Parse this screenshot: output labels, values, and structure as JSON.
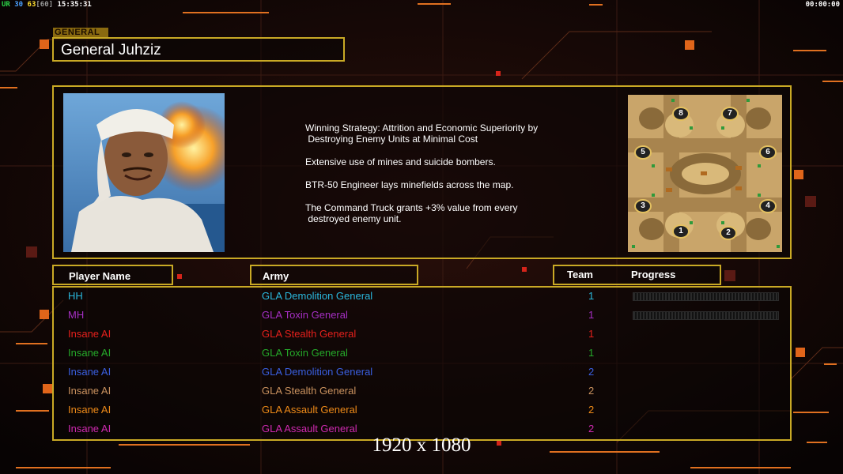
{
  "hud": {
    "left_prefix": "UR",
    "fps": "30",
    "fps2": "63",
    "fps_cap": "[60]",
    "clock": "15:35:31",
    "game_timer": "00:00:00"
  },
  "general": {
    "section_tag": "GENERAL",
    "name": "General Juhziz",
    "description": [
      "Winning Strategy: Attrition and Economic Superiority by\n Destroying Enemy Units at Minimal Cost",
      "Extensive use of mines and suicide bombers.",
      "BTR-50 Engineer lays minefields across the map.",
      "The Command Truck grants +3% value from every\n destroyed enemy unit."
    ],
    "portrait_icon": "general-portrait-image"
  },
  "map": {
    "icon": "minimap-image",
    "start_positions": [
      "1",
      "2",
      "3",
      "4",
      "5",
      "6",
      "7",
      "8"
    ]
  },
  "table": {
    "headers": {
      "player_name": "Player Name",
      "army": "Army",
      "team": "Team",
      "progress": "Progress"
    },
    "rows": [
      {
        "player": "HH",
        "army": "GLA Demolition General",
        "team": "1",
        "color": "#2ab8dd",
        "progress": 0
      },
      {
        "player": "MH",
        "army": "GLA Toxin General",
        "team": "1",
        "color": "#a62fc4",
        "progress": 0
      },
      {
        "player": "Insane AI",
        "army": "GLA Stealth General",
        "team": "1",
        "color": "#e5201c"
      },
      {
        "player": "Insane AI",
        "army": "GLA Toxin General",
        "team": "1",
        "color": "#25a92a"
      },
      {
        "player": "Insane AI",
        "army": "GLA Demolition General",
        "team": "2",
        "color": "#3a5fe0"
      },
      {
        "player": "Insane AI",
        "army": "GLA Stealth General",
        "team": "2",
        "color": "#c9915e"
      },
      {
        "player": "Insane AI",
        "army": "GLA Assault General",
        "team": "2",
        "color": "#ee8a18"
      },
      {
        "player": "Insane AI",
        "army": "GLA Assault General",
        "team": "2",
        "color": "#cf2ab0"
      }
    ]
  },
  "resolution_label": "1920 x 1080",
  "colors": {
    "frame": "#c9a925",
    "accent_orange": "#f07a1a",
    "background": "#0d0605"
  }
}
